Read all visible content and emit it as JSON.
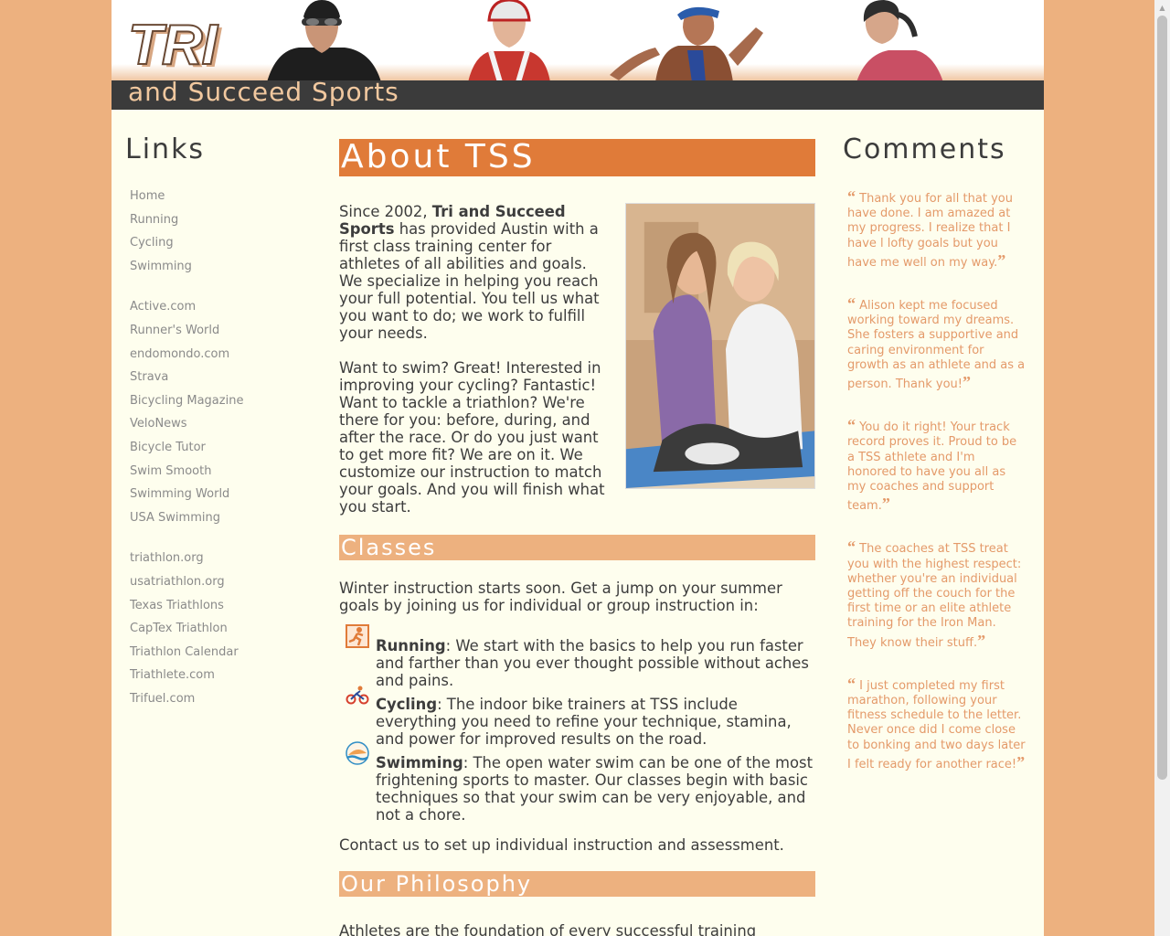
{
  "header": {
    "logo_main": "TRI",
    "logo_sub": "and Succeed Sports"
  },
  "links": {
    "heading": "Links",
    "groups": [
      [
        "Home",
        "Running",
        "Cycling",
        "Swimming"
      ],
      [
        "Active.com",
        "Runner's World",
        "endomondo.com",
        "Strava",
        "Bicycling Magazine",
        "VeloNews",
        "Bicycle Tutor",
        "Swim Smooth",
        "Swimming World",
        "USA Swimming"
      ],
      [
        "triathlon.org",
        "usatriathlon.org",
        "Texas Triathlons",
        "CapTex Triathlon",
        "Triathlon Calendar",
        "Triathlete.com",
        "Trifuel.com"
      ]
    ]
  },
  "main": {
    "about_heading": "About TSS",
    "intro_pre": "Since 2002, ",
    "intro_brand": "Tri and Succeed Sports",
    "intro_post": " has provided Austin with a first class training center for athletes of all abilities and goals. We specialize in helping you reach your full potential. You tell us what you want to do; we work to fulfill your needs.",
    "intro_p2": "Want to swim? Great! Interested in improving your cycling? Fantastic! Want to tackle a triathlon? We're there for you: before, during, and after the race. Or do you just want to get more fit? We are on it. We customize our instruction to match your goals. And you will finish what you start.",
    "classes_heading": "Classes",
    "classes_intro": "Winter instruction starts soon. Get a jump on your summer goals by joining us for individual or group instruction in:",
    "classes": [
      {
        "name": "Running",
        "icon": "runner-icon",
        "text": ": We start with the basics to help you run faster and farther than you ever thought possible without aches and pains."
      },
      {
        "name": "Cycling",
        "icon": "cyclist-icon",
        "text": ": The indoor bike trainers at TSS include everything you need to refine your technique, stamina, and power for improved results on the road."
      },
      {
        "name": "Swimming",
        "icon": "swimmer-icon",
        "text": ": The open water swim can be one of the most frightening sports to master. Our classes begin with basic techniques so that your swim can be very enjoyable, and not a chore."
      }
    ],
    "contact": "Contact us to set up individual instruction and assessment.",
    "philosophy_heading": "Our Philosophy",
    "philosophy_text": "Athletes are the foundation of every successful training"
  },
  "comments": {
    "heading": "Comments",
    "items": [
      "Thank you for all that you have done. I am amazed at my progress. I realize that I have l lofty goals but you have me well on my way.",
      "Alison kept me focused working toward my dreams. She fosters a supportive and caring environment for growth as an athlete and as a person. Thank you!",
      "You do it right! Your track record proves it. Proud to be a TSS athlete and I'm honored to have you all as my coaches and support team.",
      "The coaches at TSS treat you with the highest respect: whether you're an individual getting off the couch for the first time or an elite athlete training for the Iron Man. They know their stuff.",
      "I just completed my first marathon, following your fitness schedule to the letter. Never once did I come close to bonking and two days later I felt ready for another race!"
    ]
  },
  "colors": {
    "background": "#edb17f",
    "page": "#fefeee",
    "accent": "#e07b39",
    "section": "#edb17f",
    "comment_text": "#e49a6a"
  }
}
